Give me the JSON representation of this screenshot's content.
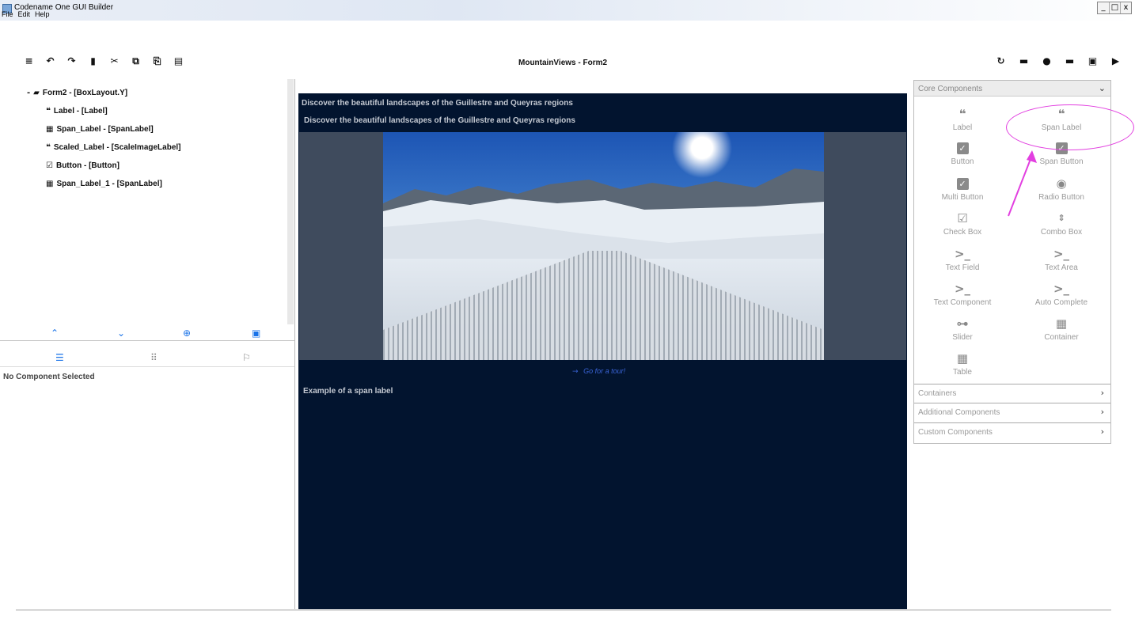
{
  "window": {
    "title": "Codename One GUI Builder",
    "controls": [
      "_",
      "□",
      "x"
    ]
  },
  "menu": {
    "items": [
      "File",
      "Edit",
      "Help"
    ]
  },
  "toolbar": {
    "title": "MountainViews - Form2",
    "left_icons": [
      "menu-icon",
      "undo-icon",
      "redo-icon",
      "delete-icon",
      "cut-icon",
      "copy-icon",
      "paste-icon",
      "list-icon"
    ],
    "right_icons": [
      "refresh-icon",
      "save-icon",
      "record-icon",
      "save-icon",
      "save-alt-icon",
      "play-icon"
    ]
  },
  "tree": {
    "nodes": [
      {
        "glyph": "-",
        "icon": "folder-icon",
        "label": "Form2 - [BoxLayout.Y]"
      },
      {
        "icon": "label-icon",
        "label": "Label - [Label]"
      },
      {
        "icon": "span-label-icon",
        "label": "Span_Label - [SpanLabel]"
      },
      {
        "icon": "label-icon",
        "label": "Scaled_Label - [ScaleImageLabel]"
      },
      {
        "icon": "button-icon",
        "label": "Button - [Button]"
      },
      {
        "icon": "span-label-icon",
        "label": "Span_Label_1 - [SpanLabel]"
      }
    ]
  },
  "properties": {
    "empty_text": "No Component Selected"
  },
  "canvas": {
    "label_text": "Discover the beautiful landscapes of the Guillestre and Queyras regions",
    "span_label_text": "Discover the beautiful landscapes of the Guillestre and Queyras regions",
    "button_text": "Go for a tour!",
    "span_label_1_text": "Example of a span label"
  },
  "palette": {
    "core_title": "Core Components",
    "items": [
      "Label",
      "Span Label",
      "Button",
      "Span Button",
      "Multi Button",
      "Radio Button",
      "Check Box",
      "Combo Box",
      "Text Field",
      "Text Area",
      "Text Component",
      "Auto Complete",
      "Slider",
      "Container",
      "Table"
    ],
    "sections": [
      "Containers",
      "Additional Components",
      "Custom Components"
    ]
  },
  "colors": {
    "canvas_bg": "#02142f",
    "accent": "#1a73e8",
    "annotation": "#e23fe0"
  }
}
